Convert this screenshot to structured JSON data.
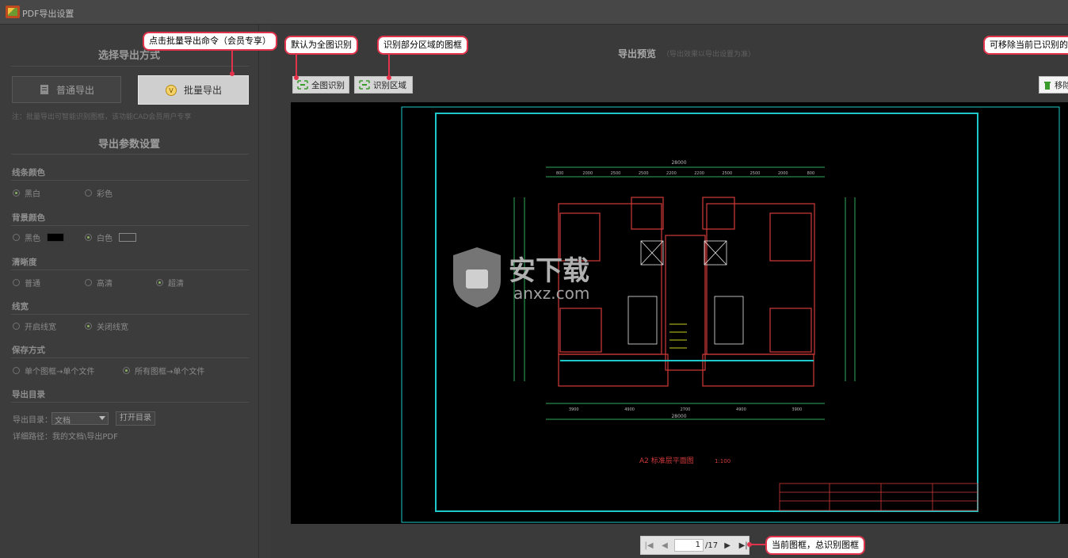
{
  "window": {
    "title": "PDF导出设置"
  },
  "left": {
    "export_mode_title": "选择导出方式",
    "normal_export": "普通导出",
    "batch_export": "批量导出",
    "note": "注：批量导出可智能识别图框，该功能CAD会员用户专享",
    "params_title": "导出参数设置",
    "line_color": {
      "title": "线条颜色",
      "options": [
        "黑白",
        "彩色"
      ],
      "selected": "黑白"
    },
    "bg_color": {
      "title": "背景颜色",
      "options": [
        "黑色",
        "白色"
      ],
      "selected": "白色",
      "swatches": [
        "#000000",
        "#ffffff"
      ]
    },
    "clarity": {
      "title": "清晰度",
      "options": [
        "普通",
        "高清",
        "超清"
      ],
      "selected": "超清"
    },
    "line_width": {
      "title": "线宽",
      "options": [
        "开启线宽",
        "关闭线宽"
      ],
      "selected": "关闭线宽"
    },
    "save_mode": {
      "title": "保存方式",
      "options": [
        "单个图框→单个文件",
        "所有图框→单个文件"
      ],
      "selected": "所有图框→单个文件"
    },
    "export_dir": {
      "title": "导出目录",
      "label": "导出目录：",
      "value": "文档",
      "open_button": "打开目录",
      "path": "详细路径：我的文档\\导出PDF"
    }
  },
  "right": {
    "preview_title": "导出预览",
    "preview_hint": "（导出效果以导出设置为准）",
    "full_recognize": "全图识别",
    "region_recognize": "识别区域",
    "remove": "移除",
    "drawing": {
      "title": "A2 标准层平面图",
      "scale": "1:100",
      "top_dim": "28000",
      "bottom_dim": "28000",
      "top_dims": [
        "800",
        "2000",
        "2500",
        "2500",
        "2200",
        "2200",
        "2500",
        "2500",
        "2000",
        "800"
      ],
      "bottom_dims": [
        "3900",
        "4900",
        "2700",
        "4900",
        "3900"
      ]
    },
    "pager": {
      "current": "1",
      "total": "/17"
    }
  },
  "callouts": {
    "batch": "点击批量导出命令（会员专享）",
    "full": "默认为全图识别",
    "region": "识别部分区域的图框",
    "remove": "可移除当前已识别的",
    "pager": "当前图框，总识别图框"
  },
  "watermark": {
    "cn": "安下载",
    "en": "anxz.com"
  },
  "colors": {
    "accent_red": "#e2334d",
    "cad_cyan": "#1ec8c8",
    "cad_red": "#d23a3a"
  }
}
